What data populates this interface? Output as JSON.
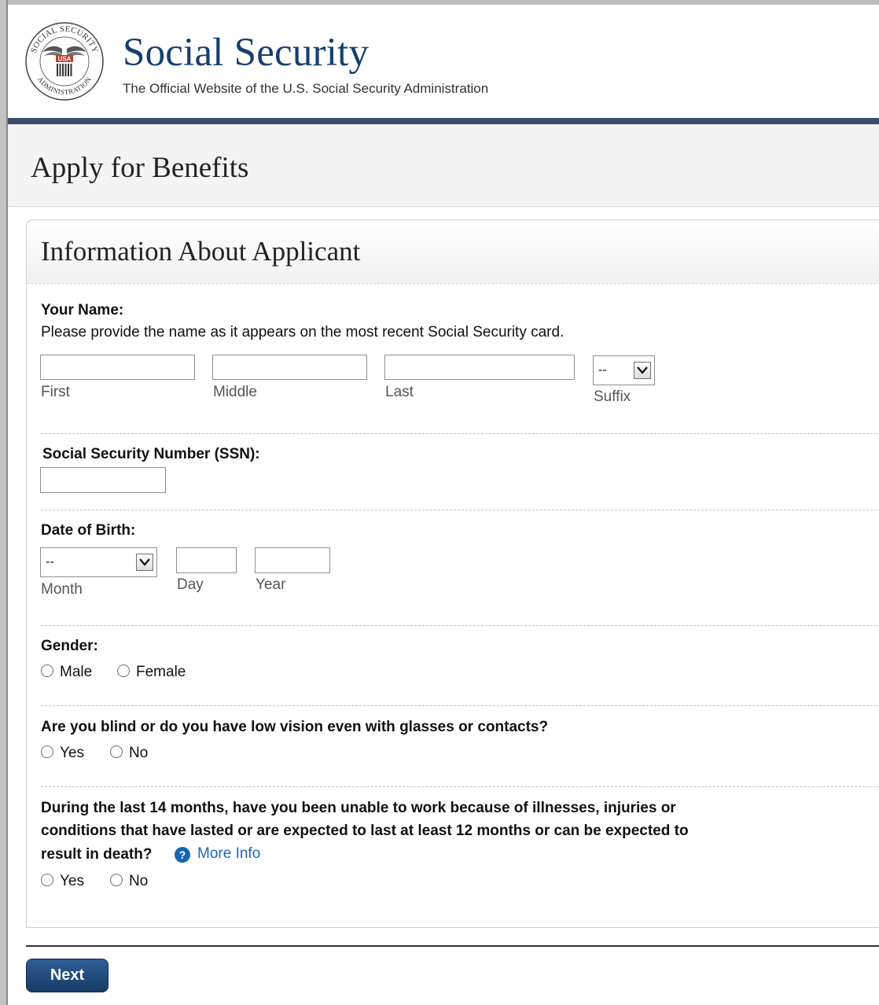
{
  "header": {
    "title": "Social Security",
    "tagline": "The Official Website of the U.S. Social Security Administration",
    "seal_text_top": "SOCIAL SECURITY",
    "seal_text_bottom": "ADMINISTRATION",
    "seal_badge": "USA"
  },
  "page": {
    "title": "Apply for Benefits"
  },
  "section": {
    "title": "Information About Applicant"
  },
  "name": {
    "label": "Your Name:",
    "instructions": "Please provide the name as it appears on the most recent Social Security card.",
    "first": {
      "caption": "First",
      "value": ""
    },
    "middle": {
      "caption": "Middle",
      "value": ""
    },
    "last": {
      "caption": "Last",
      "value": ""
    },
    "suffix": {
      "caption": "Suffix",
      "selected": "--"
    }
  },
  "ssn": {
    "label": "Social Security Number (SSN):",
    "value": ""
  },
  "dob": {
    "label": "Date of Birth:",
    "month": {
      "caption": "Month",
      "selected": "--"
    },
    "day": {
      "caption": "Day",
      "value": ""
    },
    "year": {
      "caption": "Year",
      "value": ""
    }
  },
  "gender": {
    "label": "Gender:",
    "options": [
      "Male",
      "Female"
    ]
  },
  "blind": {
    "question": "Are you blind or do you have low vision even with glasses or contacts?",
    "options": [
      "Yes",
      "No"
    ]
  },
  "disability": {
    "question_lines": [
      "During the last 14 months, have you been unable to work because of illnesses, injuries or",
      "conditions that have lasted or are expected to last at least 12 months or can be expected to",
      "result in death?"
    ],
    "help_glyph": "?",
    "more_info": "More Info",
    "options": [
      "Yes",
      "No"
    ]
  },
  "actions": {
    "next_label": "Next"
  },
  "colors": {
    "brand": "#173e6e",
    "header_bar": "#3a4b6c",
    "link": "#1c67b8",
    "button": "#1f4a7a"
  }
}
